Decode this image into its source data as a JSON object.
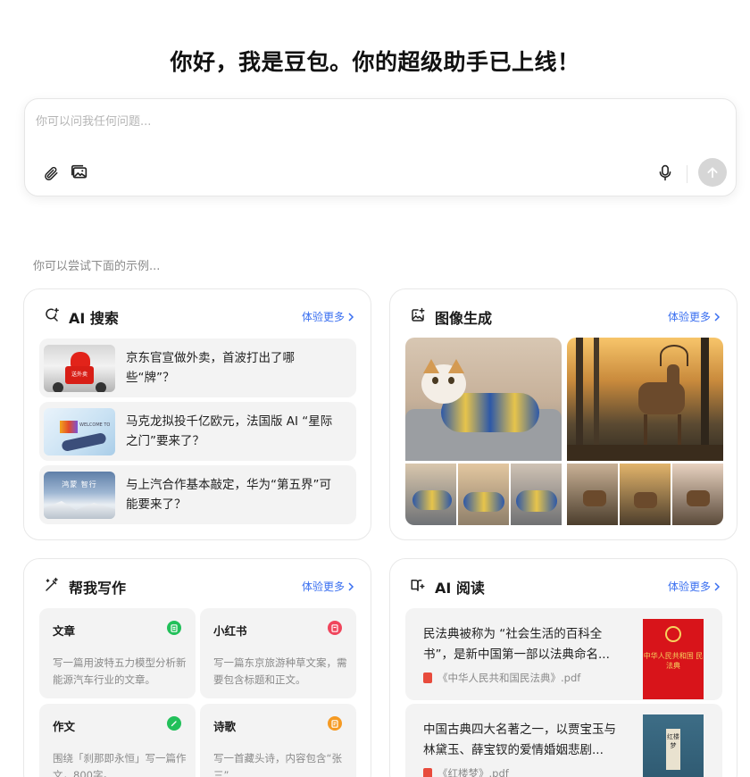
{
  "header": {
    "title": "你好，我是豆包。你的超级助手已上线！"
  },
  "chat": {
    "placeholder": "你可以问我任何问题..."
  },
  "hint": "你可以尝试下面的示例...",
  "more_label": "体验更多",
  "search_card": {
    "title": "AI 搜索",
    "items": [
      {
        "text": "京东官宣做外卖，首波打出了哪些“牌”？",
        "thumb_text": "送外卖"
      },
      {
        "text": "马克龙拟投千亿欧元，法国版 AI “星际之门”要来了？",
        "thumb_text": "WELCOME TO"
      },
      {
        "text": "与上汽合作基本敲定，华为“第五界”可能要来了？",
        "thumb_text": "鸿蒙 智行"
      }
    ]
  },
  "image_card": {
    "title": "图像生成"
  },
  "write_card": {
    "title": "帮我写作",
    "items": [
      {
        "title": "文章",
        "desc": "写一篇用波特五力模型分析新能源汽车行业的文章。",
        "badge_color": "#22c05a"
      },
      {
        "title": "小红书",
        "desc": "写一篇东京旅游种草文案，需要包含标题和正文。",
        "badge_color": "#f0455c"
      },
      {
        "title": "作文",
        "desc": "围绕「刹那即永恒」写一篇作文，800字。",
        "badge_color": "#22c05a"
      },
      {
        "title": "诗歌",
        "desc": "写一首藏头诗，内容包含“张三”",
        "badge_color": "#f59a23"
      }
    ]
  },
  "read_card": {
    "title": "AI 阅读",
    "items": [
      {
        "text": "民法典被称为 “社会生活的百科全书”，是新中国第一部以法典命名...",
        "file": "《中华人民共和国民法典》.pdf",
        "cover_text": "中华人民共和国 民法典"
      },
      {
        "text": "中国古典四大名著之一，以贾宝玉与林黛玉、薛宝钗的爱情婚姻悲剧...",
        "file": "《红楼梦》.pdf",
        "cover_text": "红楼梦"
      }
    ]
  },
  "colors": {
    "accent": "#3a6ff0",
    "send_disabled": "#d6d6d6",
    "card_item_bg": "#f3f3f3"
  }
}
